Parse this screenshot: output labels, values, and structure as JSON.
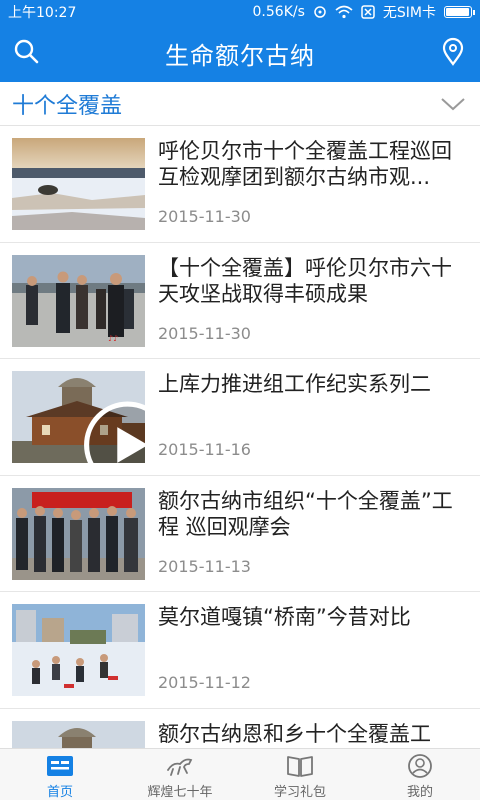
{
  "status": {
    "time": "上午10:27",
    "speed": "0.56K/s",
    "carrier": "无SIM卡",
    "battery_level": 0.95
  },
  "header": {
    "title": "生命额尔古纳",
    "search_icon": "search-icon",
    "location_icon": "location-pin-icon"
  },
  "category": {
    "label": "十个全覆盖",
    "dropdown_icon": "chevron-down-icon"
  },
  "news": [
    {
      "title": "呼伦贝尔市十个全覆盖工程巡回互检观摩团到额尔古纳市观...",
      "date": "2015-11-30",
      "thumb": "snow-landscape",
      "video": false
    },
    {
      "title": "【十个全覆盖】呼伦贝尔市六十天攻坚战取得丰硕成果",
      "date": "2015-11-30",
      "thumb": "officials-walking",
      "video": false
    },
    {
      "title": "上库力推进组工作纪实系列二",
      "date": "2015-11-16",
      "thumb": "wooden-building",
      "video": true
    },
    {
      "title": "额尔古纳市组织“十个全覆盖”工程 巡回观摩会",
      "date": "2015-11-13",
      "thumb": "group-meeting",
      "video": false
    },
    {
      "title": "莫尔道嘎镇“桥南”今昔对比",
      "date": "2015-11-12",
      "thumb": "snow-street",
      "video": false
    },
    {
      "title": "额尔古纳恩和乡十个全覆盖工",
      "date": "",
      "thumb": "wooden-building",
      "video": false
    }
  ],
  "tabs": [
    {
      "label": "首页",
      "icon": "home-news-icon",
      "active": true
    },
    {
      "label": "辉煌七十年",
      "icon": "horse-icon",
      "active": false
    },
    {
      "label": "学习礼包",
      "icon": "book-icon",
      "active": false
    },
    {
      "label": "我的",
      "icon": "profile-icon",
      "active": false
    }
  ],
  "colors": {
    "primary": "#1581e4",
    "category_text": "#1f7bd6",
    "date": "#8c8c8c"
  }
}
